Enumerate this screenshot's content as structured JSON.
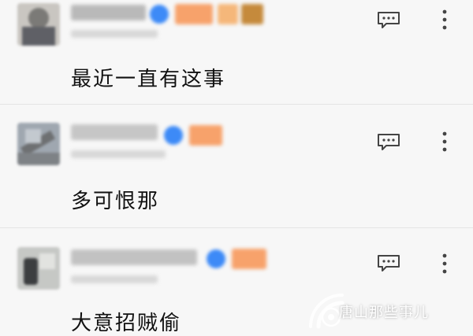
{
  "comments": [
    {
      "text": "最近一直有这事",
      "author_name": "",
      "badges": [
        "verified-badge-icon",
        "level-tag",
        "fan-tag"
      ]
    },
    {
      "text": "多可恨那",
      "author_name": "",
      "badges": [
        "verified-badge-icon",
        "level-tag"
      ]
    },
    {
      "text": "大意招贼偷",
      "author_name": "",
      "badges": [
        "verified-badge-icon",
        "level-tag"
      ]
    }
  ],
  "watermark": {
    "text": "唐山那些事儿"
  },
  "colors": {
    "background": "#f7f7f7",
    "text": "#111111",
    "icon": "#444444",
    "badge_blue": "#3d8af7",
    "tag_orange": "#f7a26b"
  }
}
